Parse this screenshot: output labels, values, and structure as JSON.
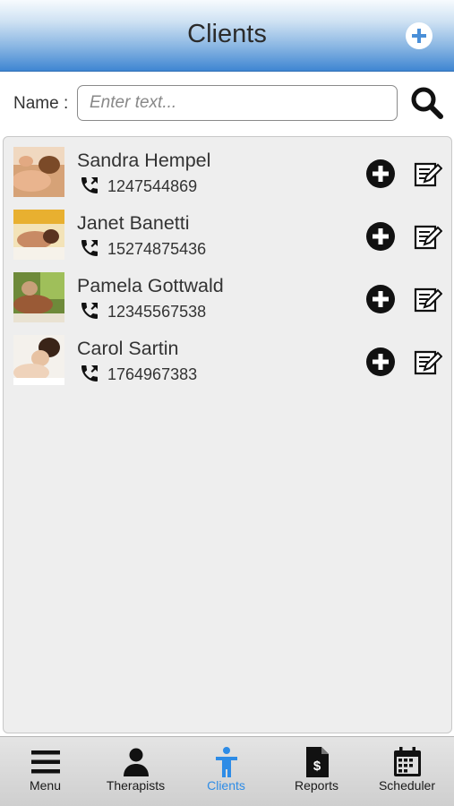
{
  "header": {
    "title": "Clients",
    "add_icon": "plus-circle-icon"
  },
  "search": {
    "label": "Name :",
    "placeholder": "Enter text...",
    "value": "",
    "icon": "search-icon"
  },
  "clients": [
    {
      "name": "Sandra Hempel",
      "phone": "1247544869"
    },
    {
      "name": "Janet Banetti",
      "phone": "15274875436"
    },
    {
      "name": "Pamela Gottwald",
      "phone": "12345567538"
    },
    {
      "name": "Carol Sartin",
      "phone": "1764967383"
    }
  ],
  "row_icons": {
    "phone": "phone-icon",
    "add": "add-circle-icon",
    "edit": "edit-note-icon"
  },
  "nav": {
    "items": [
      {
        "label": "Menu",
        "icon": "menu-icon"
      },
      {
        "label": "Therapists",
        "icon": "person-icon"
      },
      {
        "label": "Clients",
        "icon": "client-icon",
        "active": true
      },
      {
        "label": "Reports",
        "icon": "report-icon"
      },
      {
        "label": "Scheduler",
        "icon": "calendar-icon"
      }
    ]
  },
  "colors": {
    "accent": "#2e8ce6",
    "header_blue": "#3f86d2",
    "panel_bg": "#eeeeee"
  }
}
